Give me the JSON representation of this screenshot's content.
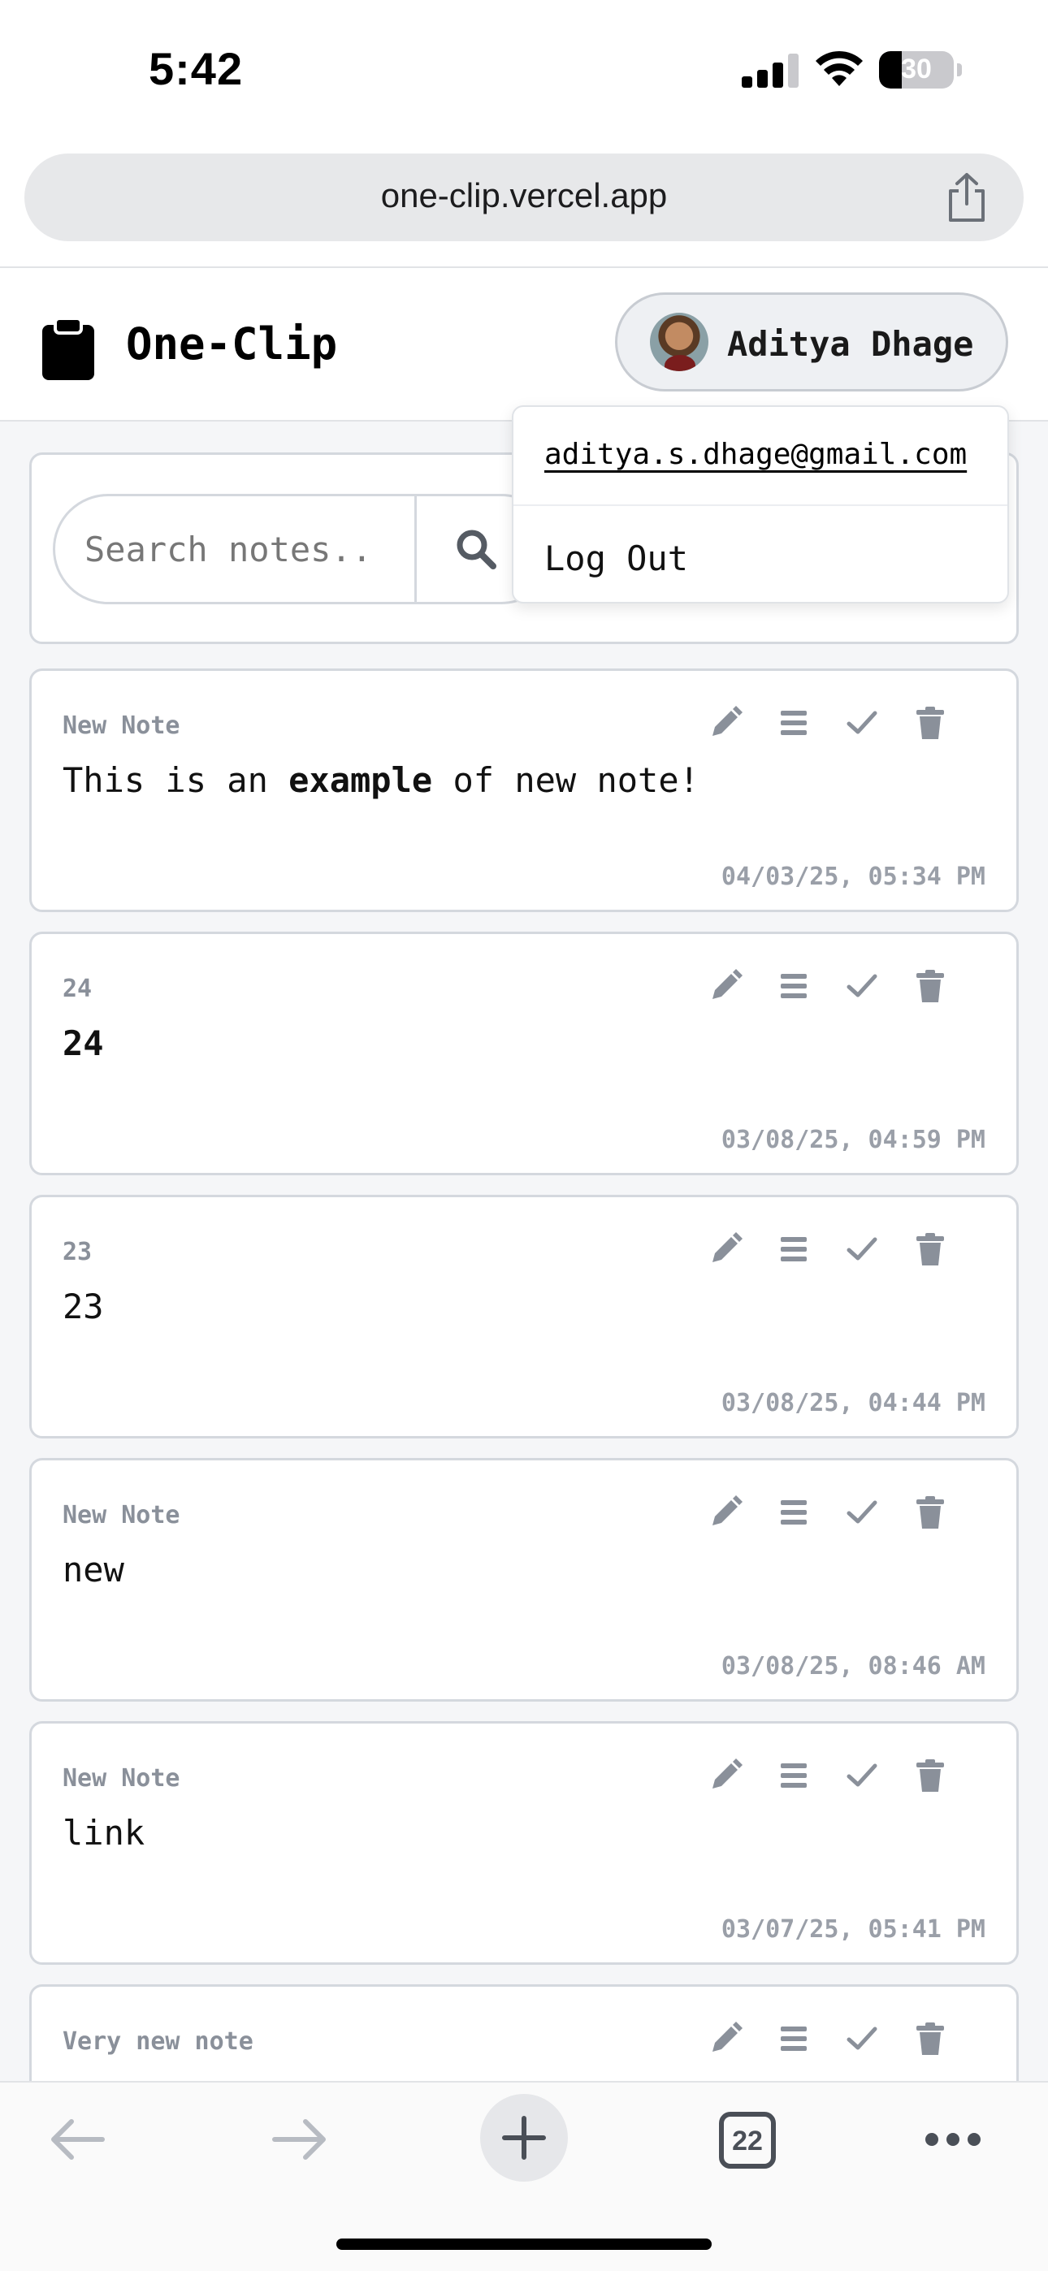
{
  "status_bar": {
    "time": "5:42",
    "battery_percent": "30",
    "battery_level": 0.3
  },
  "browser": {
    "url": "one-clip.vercel.app",
    "tab_count": "22"
  },
  "header": {
    "app_title": "One-Clip",
    "user_name": "Aditya Dhage",
    "logo_icon": "clipboard-icon"
  },
  "user_menu": {
    "email": "aditya.s.dhage@gmail.com",
    "logout_label": "Log Out"
  },
  "search": {
    "placeholder": "Search notes..",
    "icon": "search-icon"
  },
  "notes": [
    {
      "title": "New Note",
      "body_pre": "This is an ",
      "body_bold": "example",
      "body_post": " of new note!",
      "date": "04/03/25, 05:34 PM"
    },
    {
      "title": "24",
      "body": "24",
      "body_style": "bold",
      "date": "03/08/25, 04:59 PM"
    },
    {
      "title": "23",
      "body": "23",
      "date": "03/08/25, 04:44 PM"
    },
    {
      "title": "New Note",
      "body": "new",
      "date": "03/08/25, 08:46 AM"
    },
    {
      "title": "New Note",
      "body": "link",
      "date": "03/07/25, 05:41 PM"
    },
    {
      "title": "Very new note"
    }
  ],
  "note_action_icons": [
    "pencil-icon",
    "list-icon",
    "check-icon",
    "trash-icon"
  ],
  "colors": {
    "icon_gray": "#8a909a",
    "card_border": "#d4d8de",
    "page_bg": "#f5f6f8"
  }
}
